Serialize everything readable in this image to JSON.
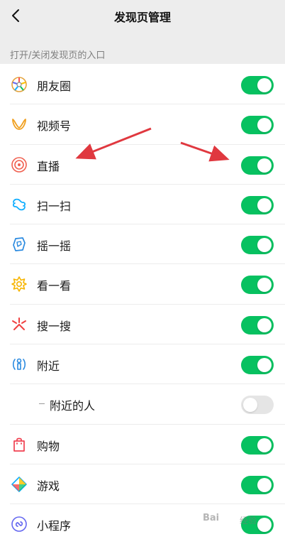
{
  "nav": {
    "title": "发现页管理",
    "back_icon": "chevron-left-icon"
  },
  "section": {
    "header": "打开/关闭发现页的入口"
  },
  "items": [
    {
      "label": "朋友圈",
      "icon": "moments-icon",
      "enabled": true
    },
    {
      "label": "视频号",
      "icon": "channels-icon",
      "enabled": true
    },
    {
      "label": "直播",
      "icon": "live-icon",
      "enabled": true
    },
    {
      "label": "扫一扫",
      "icon": "scan-icon",
      "enabled": true
    },
    {
      "label": "摇一摇",
      "icon": "shake-icon",
      "enabled": true
    },
    {
      "label": "看一看",
      "icon": "top-stories-icon",
      "enabled": true
    },
    {
      "label": "搜一搜",
      "icon": "search-icon",
      "enabled": true
    },
    {
      "label": "附近",
      "icon": "nearby-icon",
      "enabled": true
    },
    {
      "label": "附近的人",
      "icon": "",
      "enabled": false,
      "sub": true
    },
    {
      "label": "购物",
      "icon": "shopping-bag-icon",
      "enabled": true
    },
    {
      "label": "游戏",
      "icon": "game-icon",
      "enabled": true
    },
    {
      "label": "小程序",
      "icon": "mini-program-icon",
      "enabled": true
    }
  ],
  "watermark": {
    "text": "Bai",
    "sub": "经验"
  },
  "colors": {
    "toggle_on": "#07c160",
    "toggle_off": "#e5e5e5",
    "arrow": "#e0383f",
    "header_bg": "#ededed"
  }
}
